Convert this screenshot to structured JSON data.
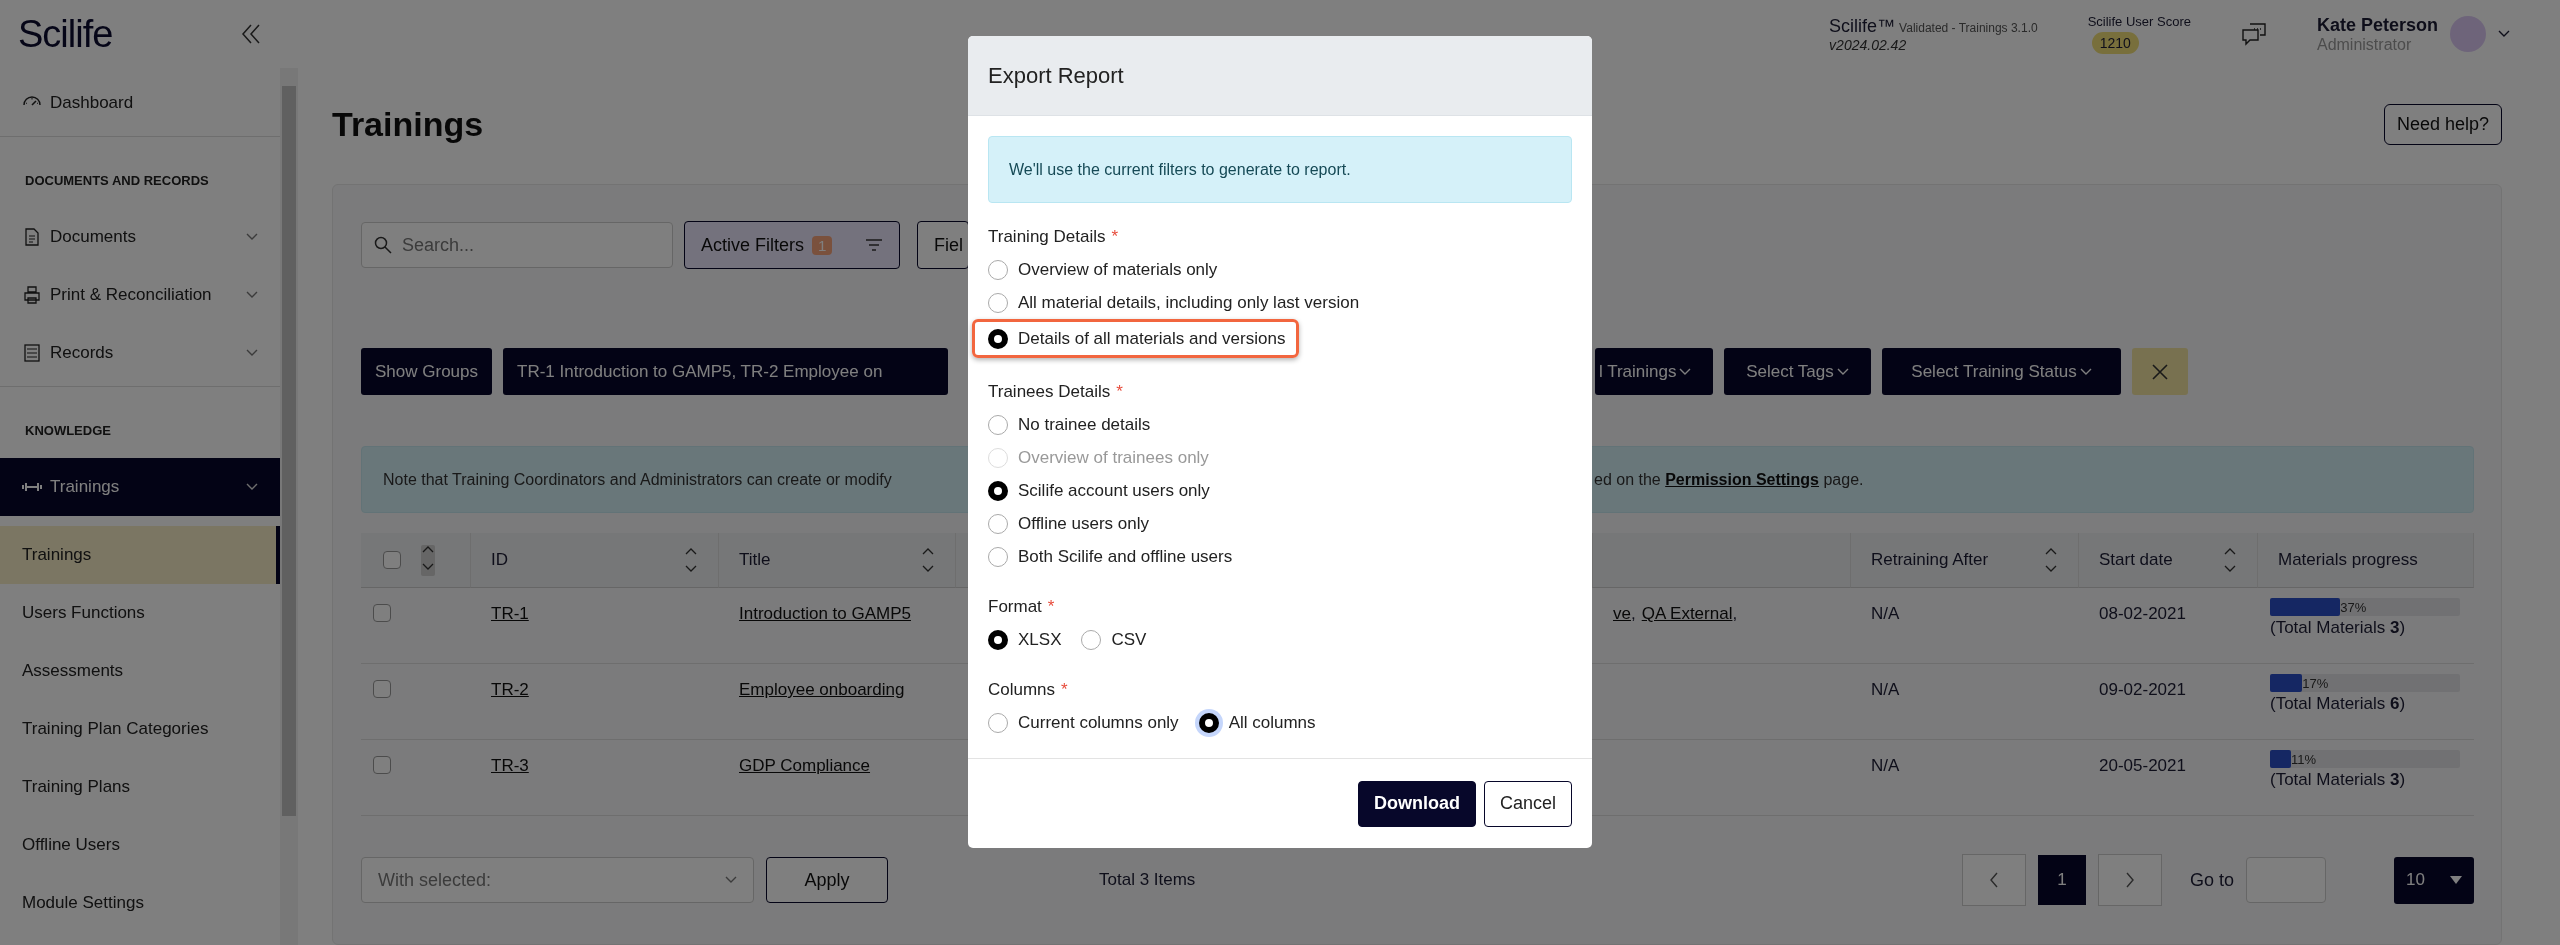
{
  "header": {
    "logo": "Scilife",
    "product": "Scilife™",
    "edition": "Validated - Trainings 3.1.0",
    "version": "v2024.02.42",
    "score_label": "Scilife User Score",
    "score": "1210",
    "user_name": "Kate Peterson",
    "user_role": "Administrator"
  },
  "sidebar": {
    "sections": [
      {
        "items": [
          {
            "kind": "link",
            "label": "Dashboard",
            "selected": false
          }
        ]
      },
      {
        "heading": "DOCUMENTS AND RECORDS",
        "items": [
          {
            "kind": "group",
            "label": "Documents",
            "selected": false
          },
          {
            "kind": "group",
            "label": "Print & Reconciliation",
            "selected": false
          },
          {
            "kind": "group",
            "label": "Records",
            "selected": false
          }
        ]
      },
      {
        "heading": "KNOWLEDGE",
        "items": [
          {
            "kind": "group",
            "label": "Trainings",
            "selected": true,
            "children": [
              {
                "label": "Trainings",
                "selected": true
              },
              {
                "label": "Users Functions",
                "selected": false
              },
              {
                "label": "Assessments",
                "selected": false
              },
              {
                "label": "Training Plan Categories",
                "selected": false
              },
              {
                "label": "Training Plans",
                "selected": false
              },
              {
                "label": "Offline Users",
                "selected": false
              },
              {
                "label": "Module Settings",
                "selected": false
              }
            ]
          }
        ]
      }
    ]
  },
  "page": {
    "title": "Trainings",
    "help_button": "Need help?"
  },
  "toolbar": {
    "search": {
      "placeholder": "Search..."
    },
    "filters_button": {
      "label": "Active Filters",
      "count": "1"
    },
    "fields_button": {
      "label": "Fiel"
    }
  },
  "chips": [
    {
      "kind": "button",
      "label": "Show Groups"
    },
    {
      "kind": "cut",
      "label": "TR-1 Introduction to GAMP5, TR-2 Employee on"
    },
    {
      "kind": "dropdown",
      "label": "l Trainings"
    },
    {
      "kind": "dropdown",
      "label": "Select Tags"
    },
    {
      "kind": "dropdown",
      "label": "Select Training Status"
    },
    {
      "kind": "clear"
    }
  ],
  "notice": {
    "text_left": "Note that Training Coordinators and Administrators can create or modify",
    "prefix": "ed on the",
    "link": "Permission Settings",
    "suffix": "page."
  },
  "table": {
    "select_all": {
      "checked": false
    },
    "columns_left": [
      {
        "label": "ID"
      },
      {
        "label": "Title"
      }
    ],
    "columns_right": [
      {
        "label": "Retraining After",
        "sortable": true
      },
      {
        "label": "Start date",
        "sortable": true
      },
      {
        "label": "Materials progress",
        "sortable": false
      }
    ],
    "rows": [
      {
        "selected": false,
        "id": "TR-1",
        "title": "Introduction to GAMP5",
        "column_4": [
          {
            "text": "ve",
            "sep": ","
          },
          {
            "text": "QA External",
            "sep": ","
          }
        ],
        "retraining_after": "N/A",
        "start_date": "08-02-2021",
        "progress": {
          "level": 0.37,
          "label": "37%",
          "total": "(Total Materials **3**)"
        }
      },
      {
        "selected": false,
        "id": "TR-2",
        "title": "Employee onboarding",
        "column_4": [],
        "retraining_after": "N/A",
        "start_date": "09-02-2021",
        "progress": {
          "level": 0.17,
          "label": "17%",
          "total": "(Total Materials **6**)"
        }
      },
      {
        "selected": false,
        "id": "TR-3",
        "title": "GDP Compliance",
        "column_4": [],
        "retraining_after": "N/A",
        "start_date": "20-05-2021",
        "progress": {
          "level": 0.11,
          "label": "11%",
          "total": "(Total Materials **3**)"
        }
      }
    ]
  },
  "footer": {
    "bulk_select": {
      "placeholder": "With selected:"
    },
    "apply_button": "Apply",
    "total": "Total 3 Items",
    "pages": [
      {
        "label": "1",
        "selected": true
      }
    ],
    "goto_label": "Go to",
    "page_size": "10"
  },
  "modal": {
    "title": "Export Report",
    "info": "We'll use the current filters to generate to report.",
    "groups": [
      {
        "label": "Training Details",
        "required_mark": "*",
        "kind": "list",
        "options": [
          {
            "label": "Overview of materials only",
            "selected": false,
            "disabled": false,
            "highlighted": false
          },
          {
            "label": "All material details, including only last version",
            "selected": false,
            "disabled": false,
            "highlighted": false
          },
          {
            "label": "Details of all materials and versions",
            "selected": true,
            "disabled": false,
            "highlighted": true
          }
        ]
      },
      {
        "label": "Trainees Details",
        "required_mark": "*",
        "kind": "list",
        "options": [
          {
            "label": "No trainee details",
            "selected": false,
            "disabled": false
          },
          {
            "label": "Overview of trainees only",
            "selected": false,
            "disabled": true
          },
          {
            "label": "Scilife account users only",
            "selected": true,
            "disabled": false
          },
          {
            "label": "Offline users only",
            "selected": false,
            "disabled": false
          },
          {
            "label": "Both Scilife and offline users",
            "selected": false,
            "disabled": false
          }
        ]
      },
      {
        "label": "Format",
        "required_mark": "*",
        "kind": "inline",
        "options": [
          {
            "label": "XLSX",
            "selected": true,
            "disabled": false
          },
          {
            "label": "CSV",
            "selected": false,
            "disabled": false
          }
        ]
      },
      {
        "label": "Columns",
        "required_mark": "*",
        "kind": "inline",
        "options": [
          {
            "label": "Current columns only",
            "selected": false,
            "disabled": false,
            "focused": false
          },
          {
            "label": "All columns",
            "selected": true,
            "disabled": false,
            "focused": true
          }
        ]
      }
    ],
    "buttons": [
      {
        "kind": "primary",
        "label": "Download"
      },
      {
        "kind": "secondary",
        "label": "Cancel"
      }
    ]
  }
}
